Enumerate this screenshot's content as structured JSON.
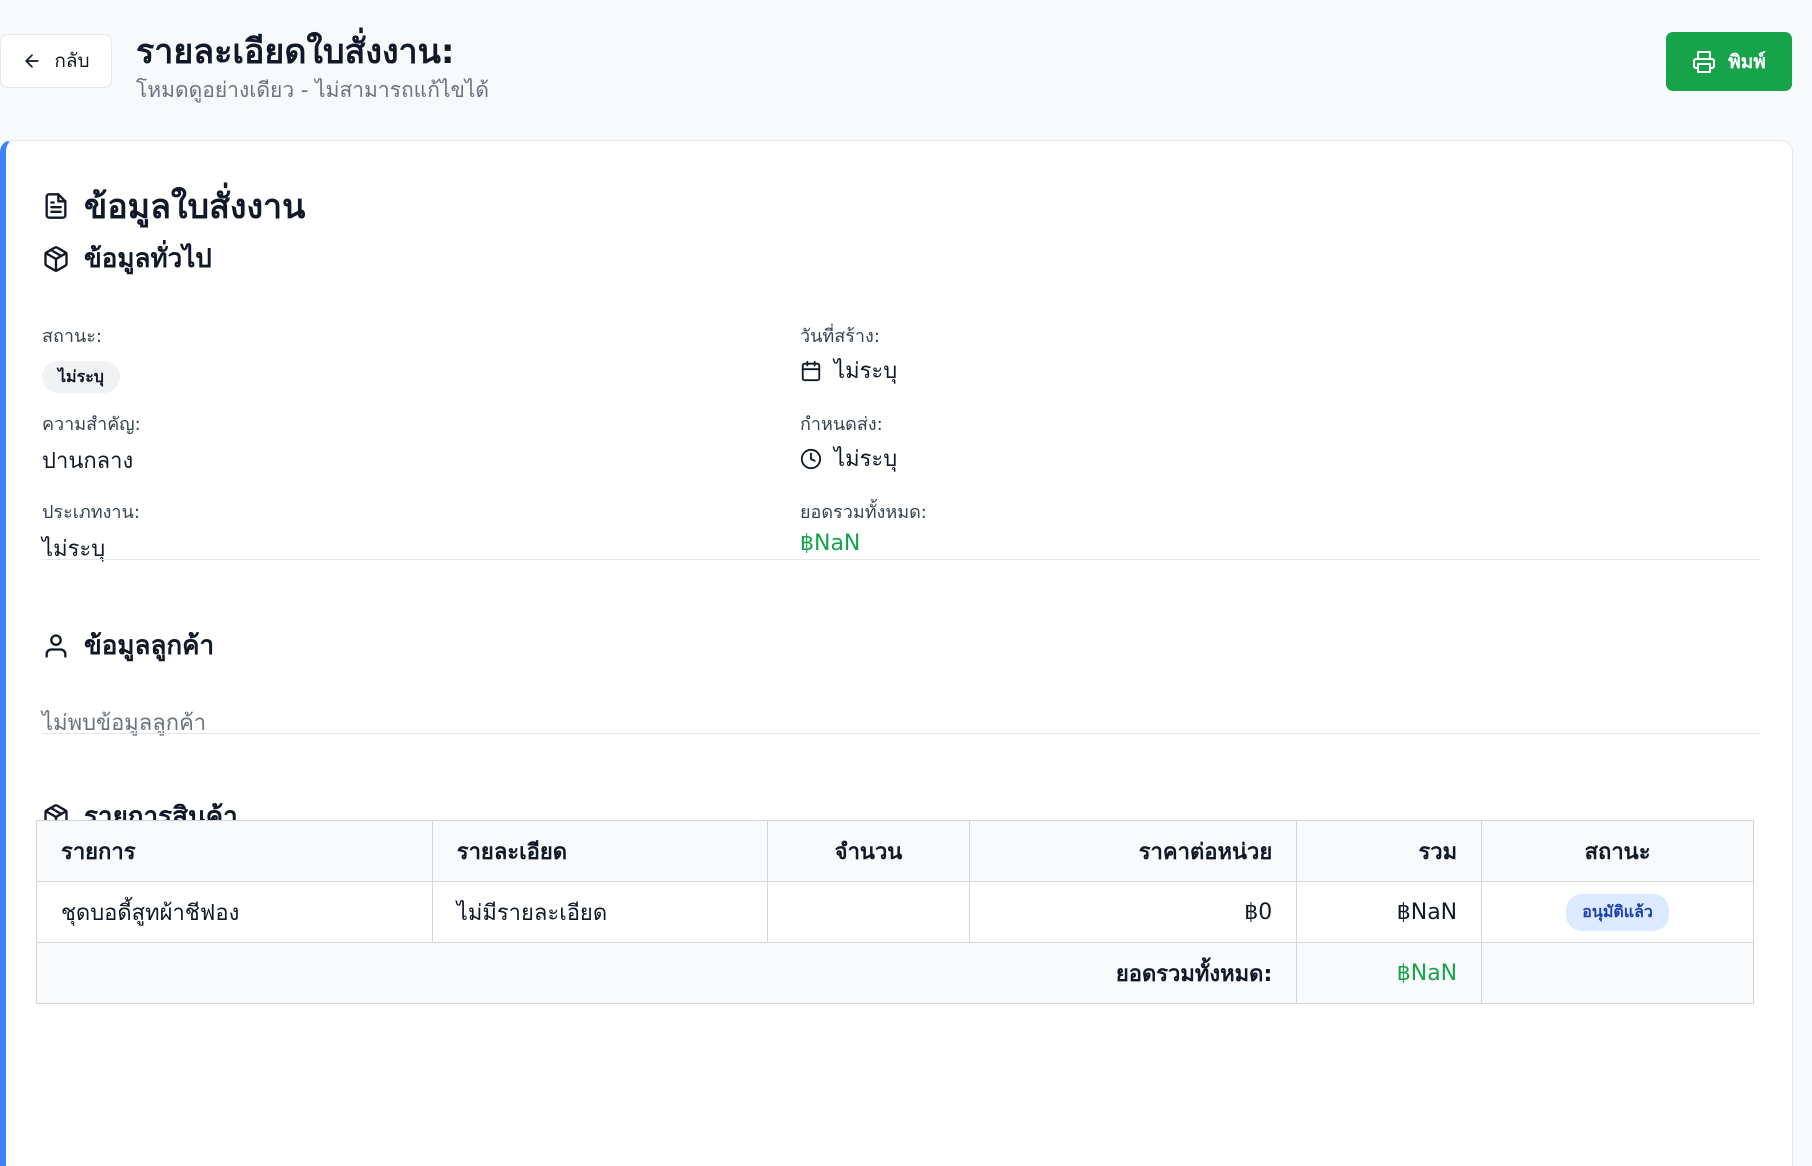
{
  "header": {
    "back_label": "กลับ",
    "title": "รายละเอียดใบสั่งงาน:",
    "subtitle": "โหมดดูอย่างเดียว - ไม่สามารถแก้ไขได้",
    "print_label": "พิมพ์"
  },
  "card": {
    "title": "ข้อมูลใบสั่งงาน"
  },
  "general": {
    "title": "ข้อมูลทั่วไป",
    "status_label": "สถานะ:",
    "status_value": "ไม่ระบุ",
    "created_label": "วันที่สร้าง:",
    "created_value": "ไม่ระบุ",
    "priority_label": "ความสำคัญ:",
    "priority_value": "ปานกลาง",
    "due_label": "กำหนดส่ง:",
    "due_value": "ไม่ระบุ",
    "job_type_label": "ประเภทงาน:",
    "job_type_value": "ไม่ระบุ",
    "total_label": "ยอดรวมทั้งหมด:",
    "total_value": "฿NaN"
  },
  "customer": {
    "title": "ข้อมูลลูกค้า",
    "empty_text": "ไม่พบข้อมูลลูกค้า"
  },
  "products": {
    "title": "รายการสินค้า",
    "columns": [
      "รายการ",
      "รายละเอียด",
      "จำนวน",
      "ราคาต่อหน่วย",
      "รวม",
      "สถานะ"
    ],
    "rows": [
      {
        "item": "ชุดบอดี้สูทผ้าชีฟอง",
        "detail": "ไม่มีรายละเอียด",
        "qty": "",
        "unit_price": "฿0",
        "total": "฿NaN",
        "status": "อนุมัติแล้ว"
      }
    ],
    "footer_label": "ยอดรวมทั้งหมด:",
    "footer_total": "฿NaN"
  },
  "colors": {
    "accent": "#3b82f6",
    "print_button": "#16a34a",
    "total_green": "#16a34a",
    "badge_bg": "#dbeafe",
    "badge_text": "#1e40af"
  }
}
